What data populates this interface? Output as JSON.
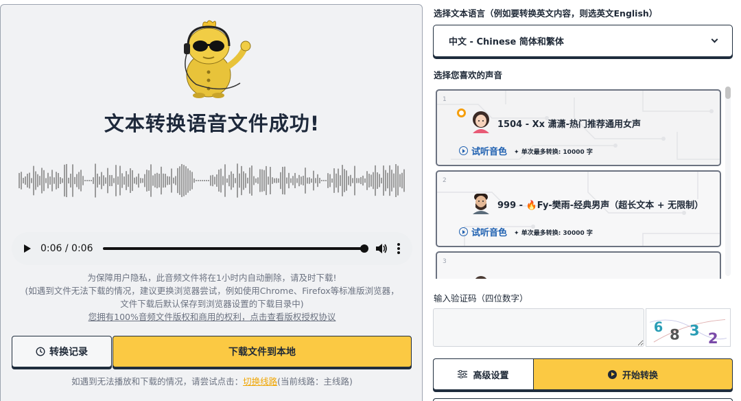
{
  "result": {
    "title": "文本转换语音文件成功!",
    "audio": {
      "time": "0:06 / 0:06",
      "progress": 1.0
    },
    "notice_lines": [
      "为保障用户隐私，此音频文件将在1小时内自动删除，请及时下载!",
      "(如遇到文件无法下载的情况，建议更换浏览器尝试，例如使用Chrome、Firefox等标准版浏览器，文件下载后默认保存到浏览器设置的下载目录中)"
    ],
    "license_link": "您拥有100%音频文件版权和商用的权利，点击查看版权授权协议",
    "history_button": "转换记录",
    "download_button": "下载文件到本地",
    "route_tip_prefix": "如遇到无法播放和下载的情况，请尝试点击：",
    "route_link": "切换线路",
    "route_suffix": "(当前线路：主线路)"
  },
  "settings": {
    "language_label": "选择文本语言（例如要转换英文内容，则选英文English）",
    "language_value": "中文 - Chinese 简体和繁体",
    "voice_label": "选择您喜欢的声音",
    "voices": [
      {
        "index": "1",
        "name": "1504 - Xx 潇潇-热门推荐通用女声",
        "listen": "试听音色",
        "limit": "单次最多转换: 10000 字",
        "selected": true
      },
      {
        "index": "2",
        "name": "999 - 🔥Fy-樊雨-经典男声（超长文本 + 无限制）",
        "listen": "试听音色",
        "limit": "单次最多转换: 30000 字",
        "selected": false
      },
      {
        "index": "3",
        "name": "",
        "listen": "",
        "limit": "",
        "selected": false
      }
    ],
    "captcha_label": "输入验证码（四位数字）",
    "captcha_digits": [
      "6",
      "8",
      "3",
      "2"
    ],
    "advanced_button": "高级设置",
    "start_button": "开始转换"
  },
  "colors": {
    "accent_yellow": "#fbc943",
    "dark_border": "#1f2d3d",
    "link_blue": "#1d5fb0",
    "route_orange": "#f0a500"
  }
}
